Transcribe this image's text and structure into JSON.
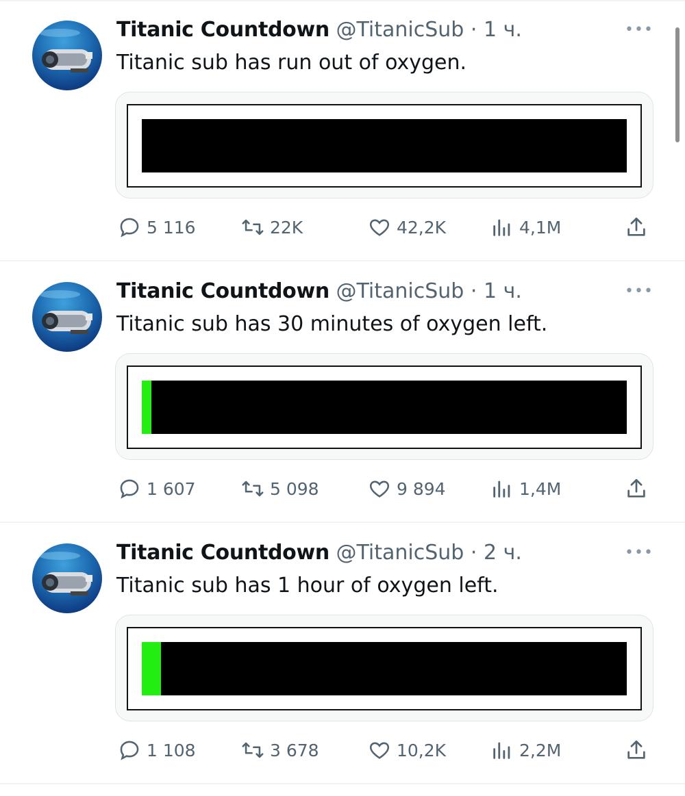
{
  "tweets": [
    {
      "name": "Titanic Countdown",
      "handle": "@TitanicSub",
      "separator": "·",
      "time": "1 ч.",
      "text": "Titanic sub has run out of oxygen.",
      "oxygen_level": 0,
      "stats": {
        "replies": "5 116",
        "retweets": "22K",
        "likes": "42,2K",
        "views": "4,1M"
      }
    },
    {
      "name": "Titanic Countdown",
      "handle": "@TitanicSub",
      "separator": "·",
      "time": "1 ч.",
      "text": "Titanic sub has 30 minutes of oxygen left.",
      "oxygen_level": 0.02,
      "stats": {
        "replies": "1 607",
        "retweets": "5 098",
        "likes": "9 894",
        "views": "1,4M"
      }
    },
    {
      "name": "Titanic Countdown",
      "handle": "@TitanicSub",
      "separator": "·",
      "time": "2 ч.",
      "text": "Titanic sub has 1 hour of oxygen left.",
      "oxygen_level": 0.04,
      "stats": {
        "replies": "1 108",
        "retweets": "3 678",
        "likes": "10,2K",
        "views": "2,2M"
      }
    }
  ],
  "colors": {
    "oxygen_fill": "#22ee11",
    "battery_empty": "#000000",
    "secondary_text": "#536471"
  },
  "icons": {
    "avatar": "submarine-avatar-icon",
    "more": "more-options-icon",
    "reply": "reply-icon",
    "retweet": "retweet-icon",
    "like": "heart-icon",
    "views": "views-chart-icon",
    "share": "share-icon"
  }
}
